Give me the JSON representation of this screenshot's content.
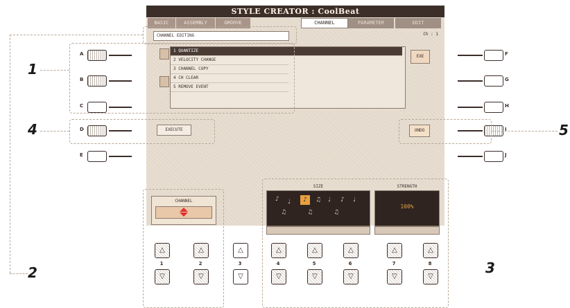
{
  "title": "STYLE CREATOR : CoolBeat",
  "tabs": [
    {
      "label": "BASIC"
    },
    {
      "label": "ASSEMBLY"
    },
    {
      "label": "GROOVE"
    },
    {
      "label": "CHANNEL"
    },
    {
      "label": "PARAMETER"
    },
    {
      "label": "EDIT"
    }
  ],
  "panel_label": "CHANNEL EDITING",
  "page_indicator": "Ch : 1",
  "channel_menu": [
    {
      "label": "1 QUANTIZE",
      "selected": true
    },
    {
      "label": "2 VELOCITY CHANGE",
      "selected": false
    },
    {
      "label": "3 CHANNEL COPY",
      "selected": false
    },
    {
      "label": "4 CH CLEAR",
      "selected": false
    },
    {
      "label": "5 REMOVE EVENT",
      "selected": false
    }
  ],
  "execute_button": "EXECUTE",
  "right_small_button": "EXE",
  "undo_button": "UNDO",
  "left_letters": [
    "A",
    "B",
    "C",
    "D",
    "E"
  ],
  "right_letters": [
    "F",
    "G",
    "H",
    "I",
    "J"
  ],
  "callouts": {
    "one": "1",
    "two": "2",
    "three": "3",
    "four": "4",
    "five": "5"
  },
  "bottom_sections": {
    "channel": "CHANNEL",
    "size": "SIZE",
    "strength": "STRENGTH",
    "strength_value": "100%"
  },
  "bottom_numbers": [
    "1",
    "2",
    "3",
    "4",
    "5",
    "6",
    "7",
    "8"
  ],
  "colors": {
    "screen_bg": "#e8dfd2",
    "title_bg": "#3c2f2a",
    "highlight": "#e8a040",
    "channel_arrow": "#e03030"
  }
}
